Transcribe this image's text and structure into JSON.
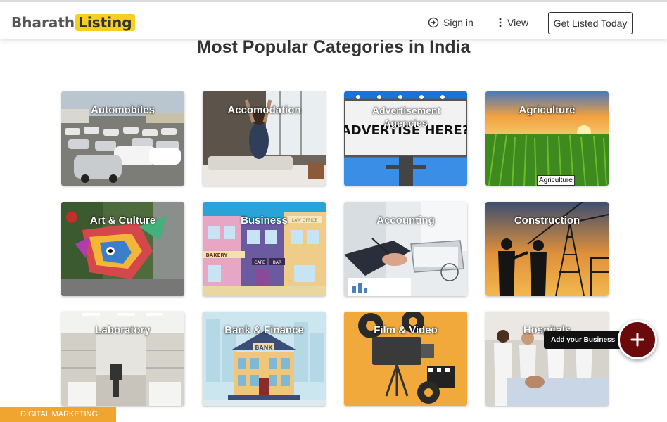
{
  "header": {
    "logo_part1": "Bharath",
    "logo_part2": "Listing",
    "signin_label": "Sign in",
    "view_label": "View",
    "cta_label": "Get Listed Today"
  },
  "main": {
    "heading": "Most Popular Categories in India",
    "categories": [
      {
        "label": "Automobiles"
      },
      {
        "label": "Accomodation"
      },
      {
        "label": "Advertisement Agencies",
        "board_text": "ADVERTISE HERE?"
      },
      {
        "label": "Agriculture"
      },
      {
        "label": "Art & Culture"
      },
      {
        "label": "Business",
        "signs": [
          "LAW OFFICE",
          "BAKERY",
          "CAFÉ",
          "BAR"
        ]
      },
      {
        "label": "Accounting"
      },
      {
        "label": "Construction"
      },
      {
        "label": "Laboratory"
      },
      {
        "label": "Bank & Finance",
        "bank_sign": "BANK"
      },
      {
        "label": "Film & Video"
      },
      {
        "label": "Hospitals"
      }
    ],
    "tooltip": "Agriculture"
  },
  "fab": {
    "tooltip": "Add your Business",
    "icon": "plus-icon"
  },
  "footer_tag": "DIGITAL MARKETING",
  "colors": {
    "brand_yellow": "#f5d020",
    "fab": "#6b0a0a",
    "tag": "#f0a530"
  }
}
